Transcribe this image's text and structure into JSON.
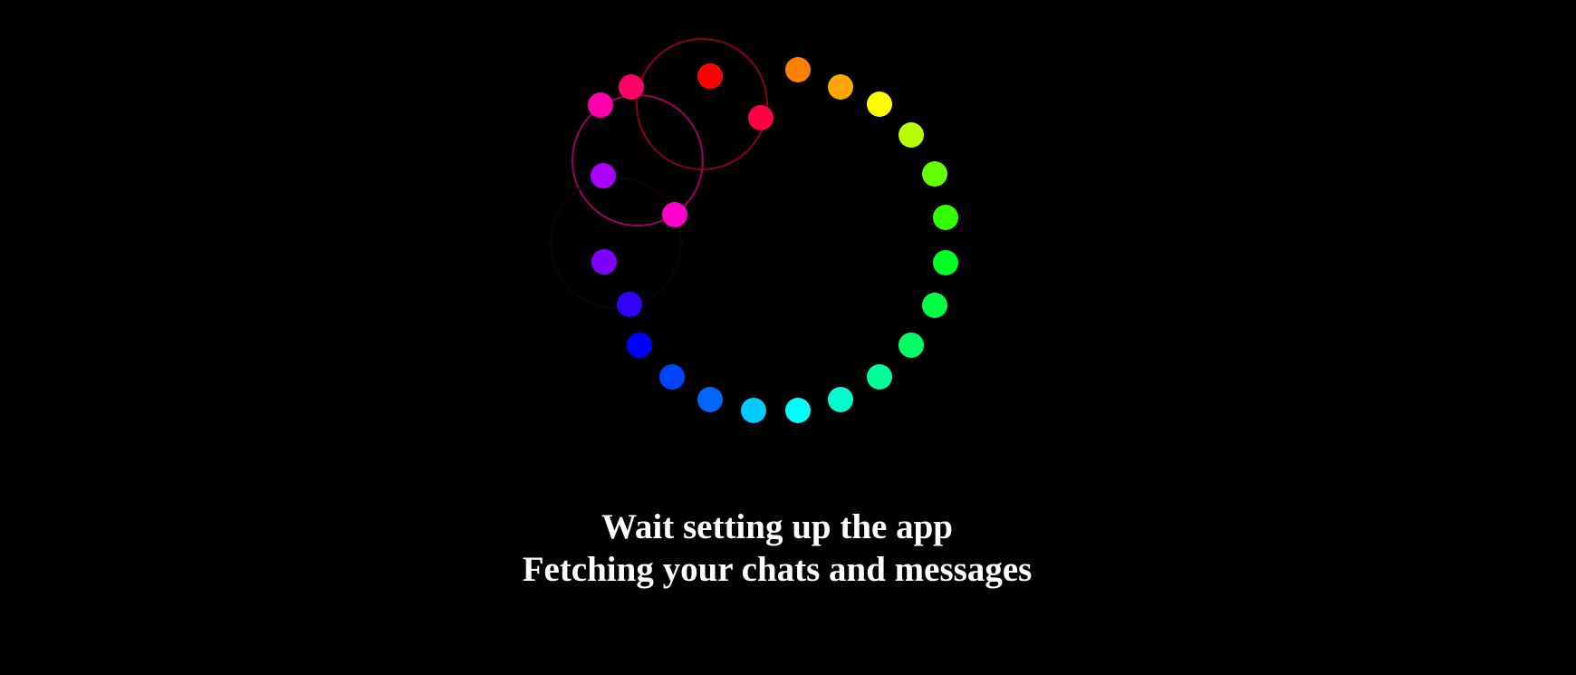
{
  "loader": {
    "name": "color-wheel-spinner",
    "dot_colors": [
      "#ff0000",
      "#ff7f00",
      "#ffa500",
      "#ffff00",
      "#b8ff00",
      "#66ff00",
      "#33ff00",
      "#00ff22",
      "#00ff44",
      "#00ff66",
      "#00ff99",
      "#00ffcc",
      "#00ffff",
      "#00ccff",
      "#0066ff",
      "#0044ff",
      "#0000ff",
      "#3300ff",
      "#7f00ff",
      "#aa00ff",
      "#ff00cc",
      "#ff00aa",
      "#ff0066",
      "#ff0044",
      "#ff0000"
    ],
    "ring_colors": [
      "#8b0015",
      "#a0005a",
      "#150010"
    ]
  },
  "messages": {
    "line1": "Wait setting up the app",
    "line2": "Fetching your chats and messages"
  }
}
